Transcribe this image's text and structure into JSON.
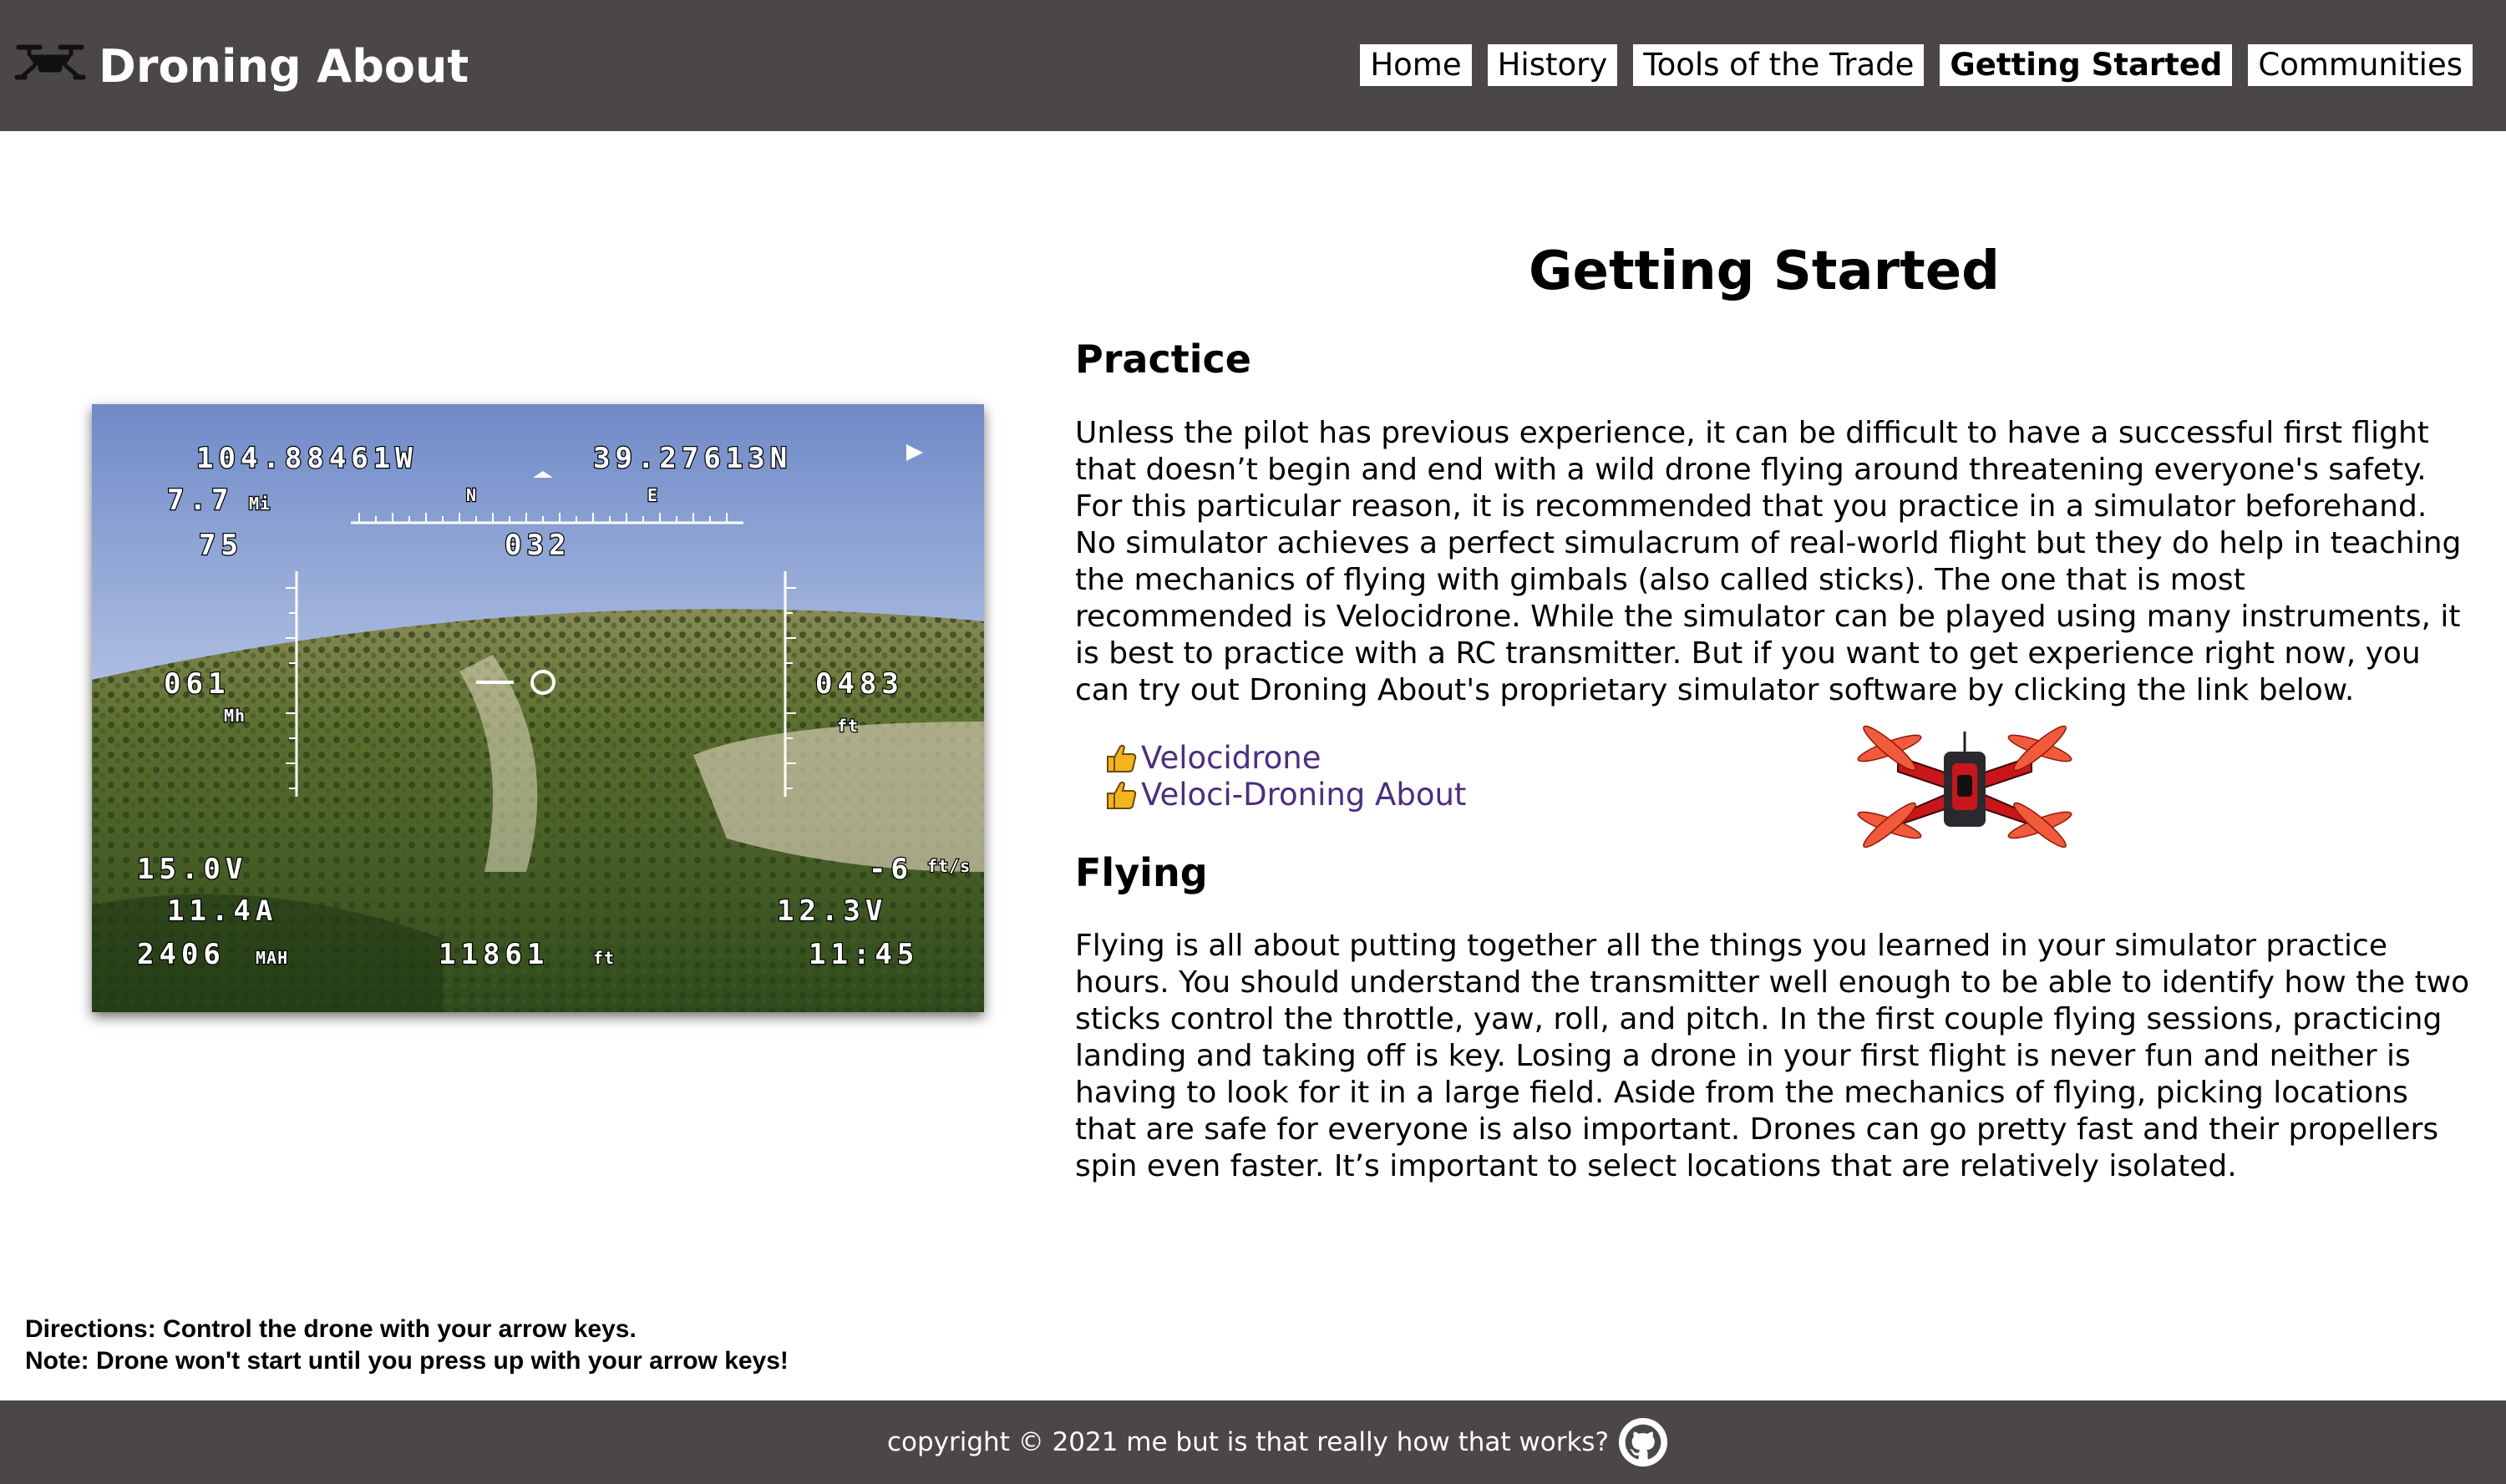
{
  "header": {
    "site_title": "Droning About",
    "nav": [
      {
        "label": "Home"
      },
      {
        "label": "History"
      },
      {
        "label": "Tools of the Trade"
      },
      {
        "label": "Getting Started",
        "active": true
      },
      {
        "label": "Communities"
      }
    ],
    "background": "#4a4649"
  },
  "hero": {
    "osd": {
      "longitude": "104.88461W",
      "latitude": "39.27613N",
      "distance": "7.7",
      "distance_unit": "Mi",
      "home_arrow": "75",
      "heading": "032",
      "compass_n": "N",
      "compass_e": "E",
      "speed": "061",
      "speed_unit": "Mh",
      "altitude": "0483",
      "altitude_unit": "ft",
      "main_voltage": "15.0V",
      "current": "11.4A",
      "capacity": "2406",
      "capacity_unit": "MAH",
      "home_distance": "11861",
      "home_distance_unit": "ft",
      "vertical_speed": "-6",
      "vertical_speed_unit": "ft/s",
      "aux_voltage": "12.3V",
      "flight_time": "11:45"
    }
  },
  "main": {
    "title": "Getting Started",
    "practice": {
      "heading": "Practice",
      "text": "Unless the pilot has previous experience, it can be difficult to have a successful first flight that doesn’t begin and end with a wild drone flying around threatening everyone's safety. For this particular reason, it is recommended that you practice in a simulator beforehand. No simulator achieves a perfect simulacrum of real-world flight but they do help in teaching the mechanics of flying with gimbals (also called sticks). The one that is most recommended is Velocidrone. While the simulator can be played using many instruments, it is best to practice with a RC transmitter. But if you want to get experience right now, you can try out Droning About's proprietary simulator software by clicking the link below.",
      "links": [
        {
          "label": "Velocidrone",
          "icon": "thumbs-up-icon"
        },
        {
          "label": "Veloci-Droning About",
          "icon": "thumbs-up-icon"
        }
      ],
      "link_color": "#4b2d83"
    },
    "flying": {
      "heading": "Flying",
      "text": "Flying is all about putting together all the things you learned in your simulator practice hours. You should understand the transmitter well enough to be able to identify how the two sticks control the throttle, yaw, roll, and pitch. In the first couple flying sessions, practicing landing and taking off is key. Losing a drone in your first flight is never fun and neither is having to look for it in a large field. Aside from the mechanics of flying, picking locations that are safe for everyone is also important. Drones can go pretty fast and their propellers spin even faster. It’s important to select locations that are relatively isolated."
    }
  },
  "directions": {
    "line1": "Directions: Control the drone with your arrow keys.",
    "line2": "Note: Drone won't start until you press up with your arrow keys!"
  },
  "footer": {
    "copyright": "copyright © 2021 me but is that really how that works?",
    "icon": "github-icon"
  }
}
